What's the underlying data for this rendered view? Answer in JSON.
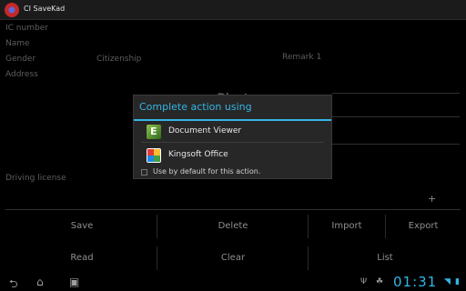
{
  "app": {
    "title": "CI SaveKad"
  },
  "form": {
    "labels": {
      "ic_number": "IC number",
      "name": "Name",
      "gender": "Gender",
      "citizenship": "Citizenship",
      "remark": "Remark 1",
      "address": "Address",
      "photo": "Photo",
      "driving_license": "Driving license",
      "add": "+"
    }
  },
  "buttons": {
    "save": "Save",
    "delete": "Delete",
    "import": "Import",
    "export": "Export",
    "read": "Read",
    "clear": "Clear",
    "list": "List"
  },
  "dialog": {
    "title": "Complete action using",
    "options": [
      {
        "label": "Document Viewer",
        "icon": "document-viewer-icon"
      },
      {
        "label": "Kingsoft Office",
        "icon": "kingsoft-office-icon"
      }
    ],
    "default_checkbox": "Use by default for this action."
  },
  "system_bar": {
    "time": "01:31",
    "accent": "#33b5e5"
  }
}
